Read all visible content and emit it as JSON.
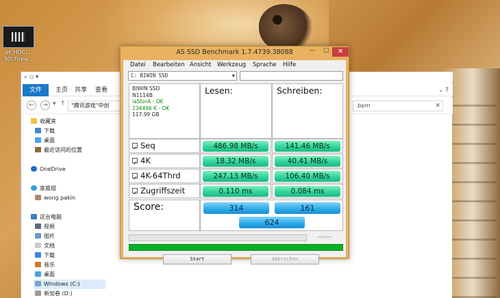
{
  "desktop_icon": {
    "label_line1": "4K HDCi...",
    "label_line2": "30\\ Firew..."
  },
  "explorer": {
    "tabs": [
      "文件",
      "主页",
      "共享",
      "查看"
    ],
    "address": "\"腾讯游戏\"中创",
    "search_value": ".bpm",
    "nav_items": [
      "收藏夹",
      "下载",
      "桌面",
      "最近访问的位置",
      "OneDrive",
      "家庭组",
      "wong pakin",
      "这台电脑",
      "视频",
      "图片",
      "文档",
      "下载",
      "音乐",
      "桌面",
      "Windows (C:)",
      "新加卷 (D:)"
    ]
  },
  "asssd": {
    "title": "AS SSD Benchmark 1.7.4739.38088",
    "menu": [
      "Datei",
      "Bearbeiten",
      "Ansicht",
      "Werkzeug",
      "Sprache",
      "Hilfe"
    ],
    "drive_select": "C: BIWIN SSD",
    "info": {
      "model": "BIWIN SSD",
      "firmware": "N1114B",
      "driver": "iaStorA - OK",
      "alignment": "234496 K - OK",
      "size": "117.99 GB"
    },
    "col_read": "Lesen:",
    "col_write": "Schreiben:",
    "rows": [
      {
        "label": "Seq",
        "read": "486.98 MB/s",
        "write": "141.46 MB/s"
      },
      {
        "label": "4K",
        "read": "18.32 MB/s",
        "write": "40.41 MB/s"
      },
      {
        "label": "4K-64Thrd",
        "read": "247.13 MB/s",
        "write": "106.40 MB/s"
      },
      {
        "label": "Zugriffszeit",
        "read": "0.110 ms",
        "write": "0.084 ms"
      }
    ],
    "score_label": "Score:",
    "score_read": "314",
    "score_write": "161",
    "score_total": "624",
    "time_display": "--:--:--",
    "progress_complete": 1.0,
    "start_button": "Start",
    "abort_button": "Abbrechen",
    "colors": {
      "value_bar": "#2fd49a",
      "score_bar": "#2aa8ea",
      "progress": "#06b025",
      "window_frame": "#e8b25e",
      "close": "#c7403a"
    }
  }
}
